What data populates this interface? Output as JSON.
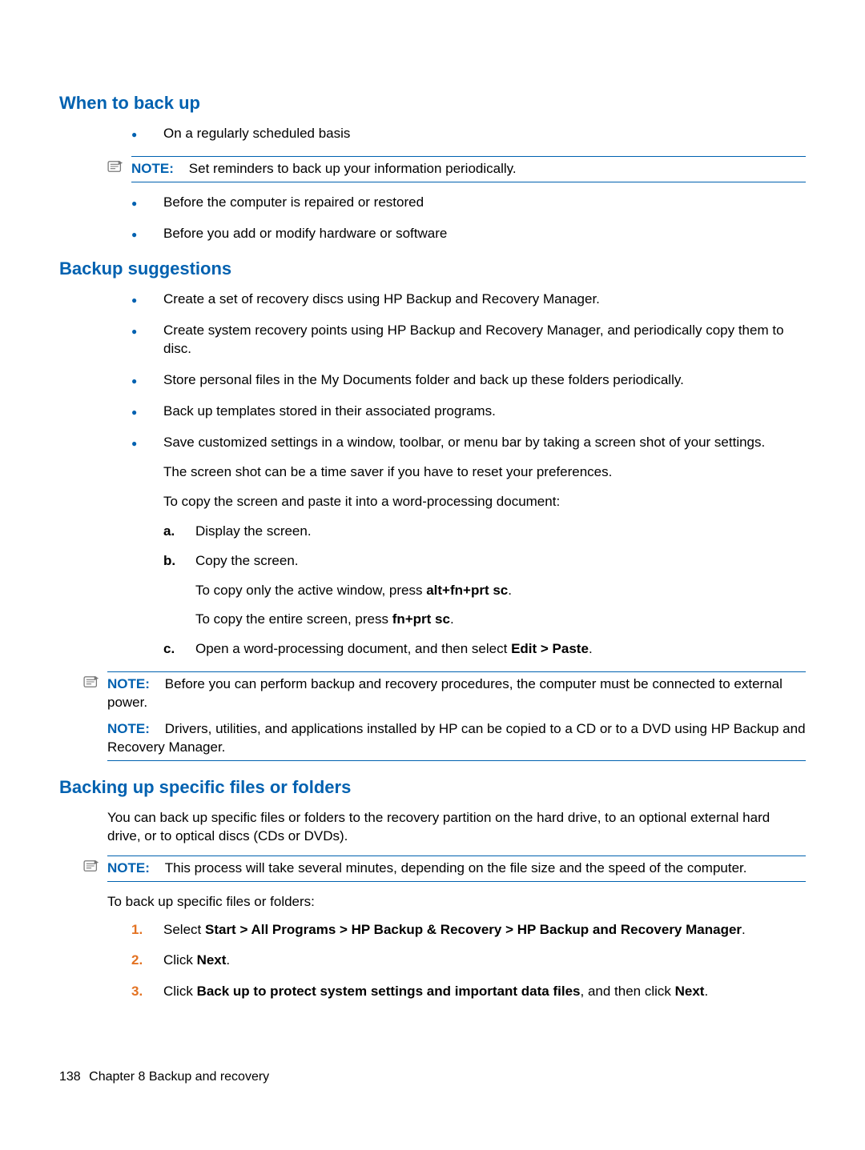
{
  "sections": {
    "when": {
      "heading": "When to back up",
      "items": [
        "On a regularly scheduled basis",
        "Before the computer is repaired or restored",
        "Before you add or modify hardware or software"
      ],
      "note": {
        "label": "NOTE:",
        "text": "Set reminders to back up your information periodically."
      }
    },
    "suggestions": {
      "heading": "Backup suggestions",
      "items": [
        "Create a set of recovery discs using HP Backup and Recovery Manager.",
        "Create system recovery points using HP Backup and Recovery Manager, and periodically copy them to disc.",
        "Store personal files in the My Documents folder and back up these folders periodically.",
        "Back up templates stored in their associated programs.",
        "Save customized settings in a window, toolbar, or menu bar by taking a screen shot of your settings."
      ],
      "sub1": "The screen shot can be a time saver if you have to reset your preferences.",
      "sub2": "To copy the screen and paste it into a word-processing document:",
      "steps": {
        "a": {
          "label": "a.",
          "text": "Display the screen."
        },
        "b": {
          "label": "b.",
          "text": "Copy the screen.",
          "line1_pre": "To copy only the active window, press ",
          "line1_key": "alt+fn+prt sc",
          "line2_pre": "To copy the entire screen, press ",
          "line2_key": "fn+prt sc"
        },
        "c": {
          "label": "c.",
          "pre": "Open a word-processing document, and then select ",
          "bold": "Edit > Paste"
        }
      },
      "note1": {
        "label": "NOTE:",
        "text": "Before you can perform backup and recovery procedures, the computer must be connected to external power."
      },
      "note2": {
        "label": "NOTE:",
        "text": "Drivers, utilities, and applications installed by HP can be copied to a CD or to a DVD using HP Backup and Recovery Manager."
      }
    },
    "specific": {
      "heading": "Backing up specific files or folders",
      "intro": "You can back up specific files or folders to the recovery partition on the hard drive, to an optional external hard drive, or to optical discs (CDs or DVDs).",
      "note": {
        "label": "NOTE:",
        "text": "This process will take several minutes, depending on the file size and the speed of the computer."
      },
      "lead": "To back up specific files or folders:",
      "steps": {
        "s1": {
          "num": "1.",
          "pre": "Select ",
          "bold": "Start > All Programs > HP Backup & Recovery > HP Backup and Recovery Manager"
        },
        "s2": {
          "num": "2.",
          "pre": "Click ",
          "bold": "Next"
        },
        "s3": {
          "num": "3.",
          "pre": "Click ",
          "bold": "Back up to protect system settings and important data files",
          "post": ", and then click ",
          "bold2": "Next"
        }
      }
    }
  },
  "footer": {
    "page": "138",
    "chapter": "Chapter 8   Backup and recovery"
  },
  "period": "."
}
